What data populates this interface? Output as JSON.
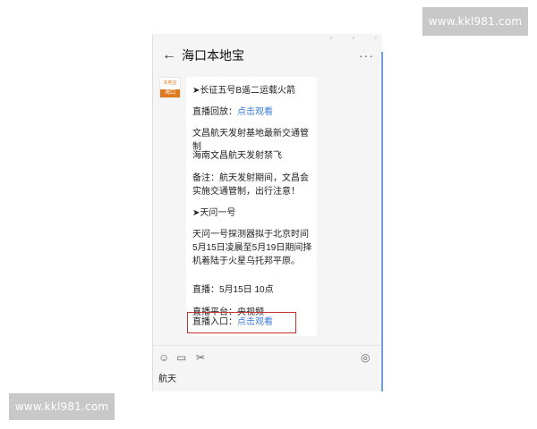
{
  "watermark": {
    "top": "www.kkl981.com",
    "bottom": "www.kkl981.com"
  },
  "window": {
    "title": "海口本地宝",
    "avatar": {
      "top_text": "本地宝",
      "bottom_text": "海口"
    }
  },
  "message": {
    "lines": [
      "➤长征五号B遥二运载火箭",
      {
        "label": "直播回放：",
        "link": "点击观看"
      },
      "文昌航天发射基地最新交通管制",
      "海南文昌航天发射禁飞",
      "备注：航天发射期间，文昌会实施交通管制，出行注意！",
      "➤天问一号",
      "天问一号探测器拟于北京时间5月15日凌晨至5月19日期间择机着陆于火星乌托邦平原。",
      "直播：5月15日 10点",
      "直播平台：央视频",
      {
        "label": "直播入口：",
        "link": "点击观看"
      }
    ]
  },
  "input": {
    "text": "航天"
  },
  "icons": [
    "back-arrow-icon",
    "more-icon",
    "emoji-icon",
    "folder-icon",
    "scissors-icon",
    "voice-icon"
  ],
  "colors": {
    "link": "#3a7bd5",
    "highlight": "#c62f2f",
    "brand": "#e07a1f"
  }
}
